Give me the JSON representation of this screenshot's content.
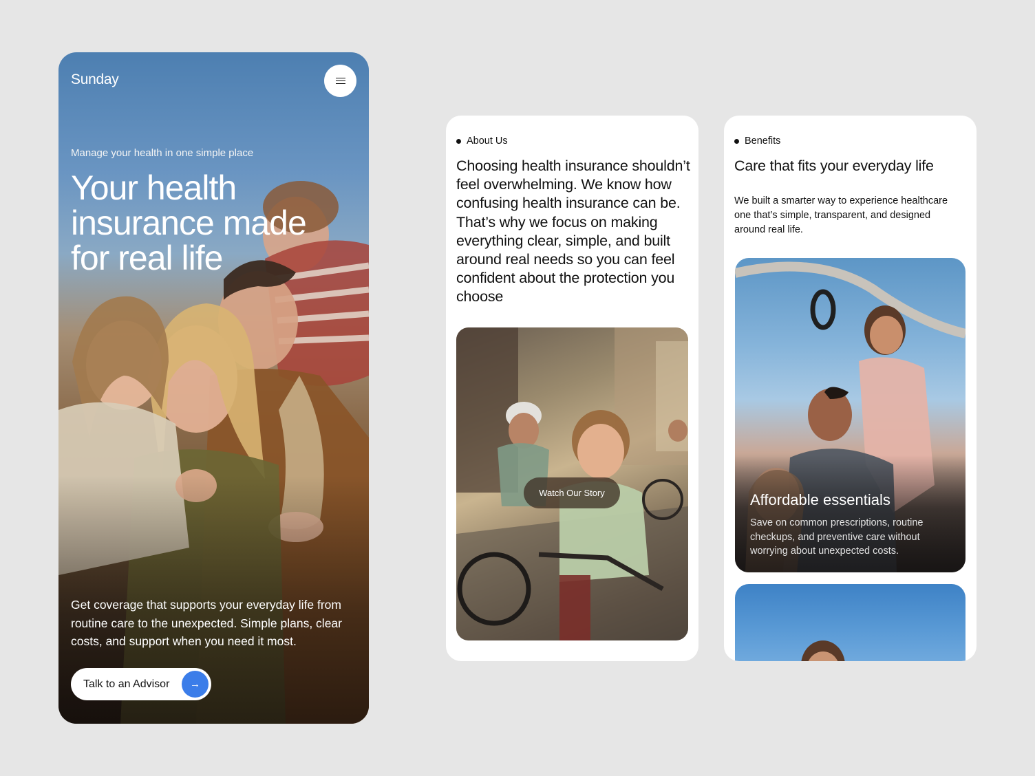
{
  "hero": {
    "logo": "Sunday",
    "eyebrow": "Manage your health in one simple place",
    "title": "Your health insurance made for real life",
    "description": "Get coverage that supports your everyday life from routine care to the unexpected. Simple plans, clear costs, and support when you need it most.",
    "cta_label": "Talk to an Advisor",
    "menu_icon": "hamburger-icon",
    "cta_icon": "arrow-right-icon",
    "accent_color": "#3b7de9"
  },
  "about": {
    "eyebrow": "About Us",
    "text": "Choosing health insurance shouldn’t feel overwhelming. We know how confusing health insurance can be. That’s why we focus on making everything clear, simple, and built around real needs so you can feel confident about the protection you choose",
    "video_button": "Watch Our Story"
  },
  "benefits": {
    "eyebrow": "Benefits",
    "title": "Care that fits your everyday life",
    "description": "We built a smarter way to experience healthcare one that’s simple, transparent, and designed around real life.",
    "cards": [
      {
        "title": "Affordable essentials",
        "description": "Save on common prescriptions, routine checkups, and preventive care without worrying about unexpected costs."
      }
    ]
  }
}
